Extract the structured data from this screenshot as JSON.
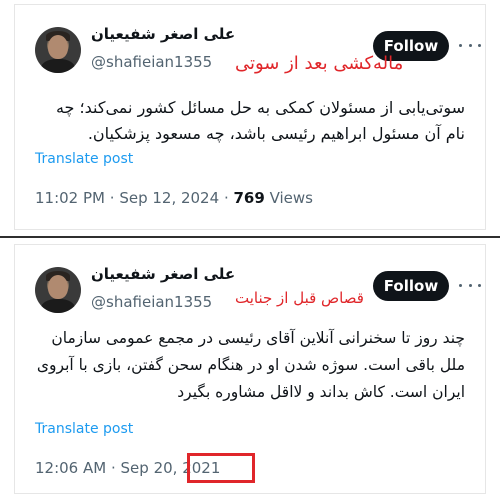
{
  "tweets": [
    {
      "author_name": "علی اصغر شفیعیان",
      "handle": "@shafieian1355",
      "follow_label": "Follow",
      "annotation": "ماله‌کشی بعد از سوتی",
      "body": "سوتی‌یابی از مسئولان کمکی به حل مسائل کشور نمی‌کند؛ چه نام آن مسئول ابراهیم رئیسی باشد، چه مسعود پزشکیان.",
      "translate_label": "Translate post",
      "time": "11:02 PM",
      "date": "Sep 12, 2024",
      "views_count": "769",
      "views_label": "Views"
    },
    {
      "author_name": "علی اصغر شفیعیان",
      "handle": "@shafieian1355",
      "follow_label": "Follow",
      "annotation": "قصاص قبل از جنایت",
      "body": "چند روز تا سخنرانی آنلاین آقای رئیسی در مجمع عمومی سازمان ملل باقی است. سوژه شدن او در هنگام سحن گفتن، بازی با آبروی ایران است. کاش بداند و لااقل مشاوره بگیرد",
      "translate_label": "Translate post",
      "time": "12:06 AM",
      "date": "Sep 20, 2021"
    }
  ],
  "colors": {
    "annotation": "#e0262a",
    "link": "#1d9bf0",
    "follow_bg": "#0f1419"
  },
  "icons": [
    "more-options-icon"
  ]
}
